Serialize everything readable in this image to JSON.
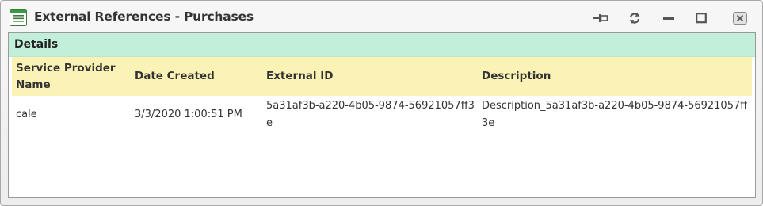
{
  "window": {
    "title": "External References - Purchases"
  },
  "titlebar_icons": {
    "app": "list-window-icon",
    "pin": "pin-icon",
    "refresh": "refresh-icon",
    "minimize": "minimize-icon",
    "maximize": "maximize-icon",
    "close": "close-icon"
  },
  "section": {
    "title": "Details"
  },
  "table": {
    "headers": [
      "Service Provider Name",
      "Date Created",
      "External ID",
      "Description"
    ],
    "rows": [
      {
        "service_provider_name": "cale",
        "date_created": "3/3/2020 1:00:51 PM",
        "external_id": "5a31af3b-a220-4b05-9874-56921057ff3e",
        "description": "Description_5a31af3b-a220-4b05-9874-56921057ff3e"
      }
    ]
  },
  "colors": {
    "section_header_bg": "#c2efd9",
    "table_header_bg": "#fbf3b5",
    "app_icon_green": "#3a9a4a"
  }
}
